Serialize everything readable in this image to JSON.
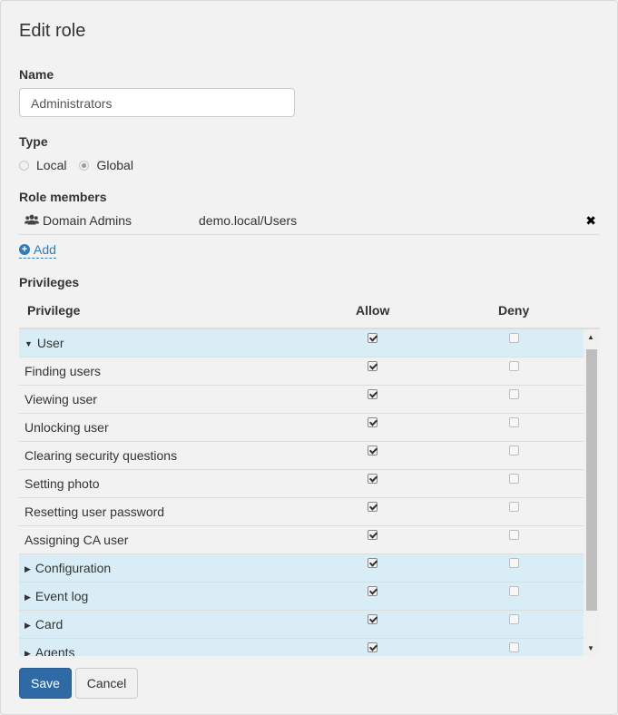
{
  "dialog": {
    "title": "Edit role",
    "name_label": "Name",
    "name_value": "Administrators",
    "type_label": "Type",
    "type_options": [
      {
        "label": "Local",
        "selected": false
      },
      {
        "label": "Global",
        "selected": true
      }
    ],
    "members_label": "Role members",
    "members": [
      {
        "name": "Domain Admins",
        "path": "demo.local/Users",
        "icon": "users-icon",
        "remove_icon": "close-icon"
      }
    ],
    "add_label": "Add",
    "privileges_label": "Privileges",
    "columns": {
      "privilege": "Privilege",
      "allow": "Allow",
      "deny": "Deny"
    },
    "rows": [
      {
        "label": "User",
        "group": true,
        "expanded": true,
        "allow": true,
        "deny": false
      },
      {
        "label": "Finding users",
        "group": false,
        "allow": true,
        "deny": false
      },
      {
        "label": "Viewing user",
        "group": false,
        "allow": true,
        "deny": false
      },
      {
        "label": "Unlocking user",
        "group": false,
        "allow": true,
        "deny": false
      },
      {
        "label": "Clearing security questions",
        "group": false,
        "allow": true,
        "deny": false
      },
      {
        "label": "Setting photo",
        "group": false,
        "allow": true,
        "deny": false
      },
      {
        "label": "Resetting user password",
        "group": false,
        "allow": true,
        "deny": false
      },
      {
        "label": "Assigning CA user",
        "group": false,
        "allow": true,
        "deny": false
      },
      {
        "label": "Configuration",
        "group": true,
        "expanded": false,
        "allow": true,
        "deny": false
      },
      {
        "label": "Event log",
        "group": true,
        "expanded": false,
        "allow": true,
        "deny": false
      },
      {
        "label": "Card",
        "group": true,
        "expanded": false,
        "allow": true,
        "deny": false
      },
      {
        "label": "Agents",
        "group": true,
        "expanded": false,
        "allow": true,
        "deny": false
      }
    ],
    "save_label": "Save",
    "cancel_label": "Cancel"
  },
  "colors": {
    "group_row": "#d9edf7",
    "primary_button": "#2f6aa6",
    "link": "#337ab7"
  }
}
